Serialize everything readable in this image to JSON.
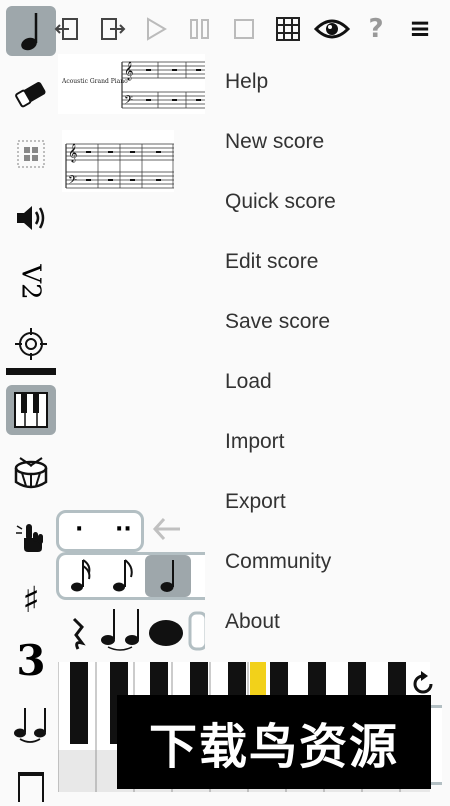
{
  "menu": {
    "items": [
      {
        "label": "Help"
      },
      {
        "label": "New score"
      },
      {
        "label": "Quick score"
      },
      {
        "label": "Edit score"
      },
      {
        "label": "Save score"
      },
      {
        "label": "Load"
      },
      {
        "label": "Import"
      },
      {
        "label": "Export"
      },
      {
        "label": "Community"
      },
      {
        "label": "About"
      }
    ]
  },
  "toolbar": {
    "help_glyph": "?",
    "menu_glyph": "≡"
  },
  "score": {
    "instrument_label": "Acoustic Grand Piano"
  },
  "left_tools": {
    "split_label": "V2",
    "tuplet_label": "3",
    "sharp_label": "♯"
  },
  "dots": {
    "single": "·",
    "double": "··"
  },
  "watermark": {
    "text": "下载鸟资源"
  },
  "colors": {
    "selected_bg": "#9ea7ab",
    "highlight_key": "#f2d11a",
    "pill_border": "#b3bfc3"
  }
}
